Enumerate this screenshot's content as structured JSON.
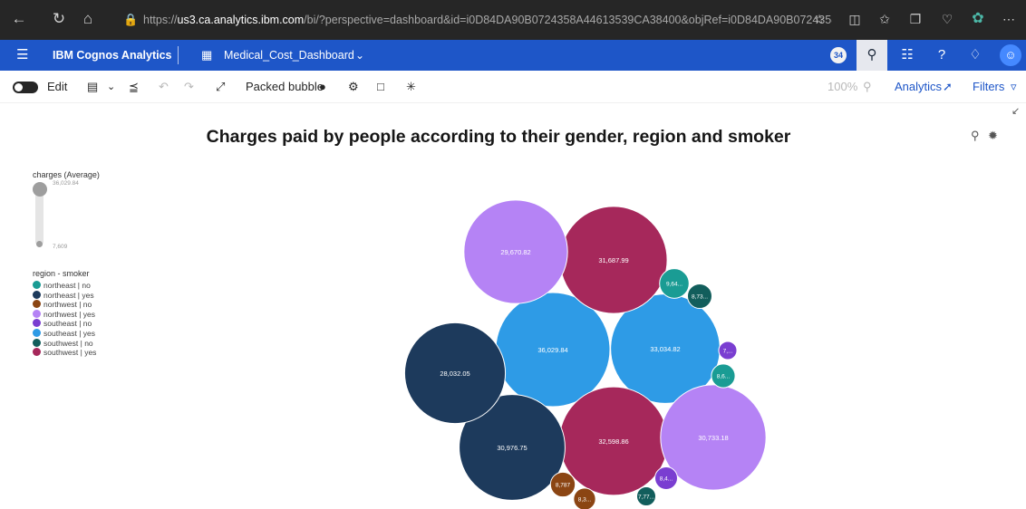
{
  "browser": {
    "url_prefix": "https://",
    "url_domain": "us3.ca.analytics.ibm.com",
    "url_rest": "/bi/?perspective=dashboard&id=i0D84DA90B0724358A44613539CA38400&objRef=i0D84DA90B0724358..."
  },
  "app": {
    "product": "IBM Cognos Analytics",
    "dashboard_name": "Medical_Cost_Dashboard",
    "notification_count": "34"
  },
  "toolbar": {
    "edit_label": "Edit",
    "visualization_label": "Packed bubble",
    "zoom_label": "100%",
    "analytics_label": "Analytics",
    "filters_label": "Filters"
  },
  "chart_data": {
    "type": "packed-bubble",
    "title": "Charges paid by people according to their gender, region and smoker",
    "size_legend": {
      "label": "charges (Average)",
      "max_label": "36,029.84",
      "min_label": "7,609"
    },
    "color_legend_title": "region - smoker",
    "categories": [
      {
        "name": "northeast | no",
        "color": "#1a9c94"
      },
      {
        "name": "northeast | yes",
        "color": "#1d3a5c"
      },
      {
        "name": "northwest | no",
        "color": "#8b4513"
      },
      {
        "name": "northwest | yes",
        "color": "#b583f5"
      },
      {
        "name": "southeast | no",
        "color": "#7a3ed1"
      },
      {
        "name": "southeast | yes",
        "color": "#2e9be6"
      },
      {
        "name": "southwest | no",
        "color": "#125e5c"
      },
      {
        "name": "southwest | yes",
        "color": "#a6285b"
      }
    ],
    "bubbles": [
      {
        "category": "southeast | yes",
        "value": 36029.84,
        "label": "36,029.84"
      },
      {
        "category": "southeast | yes",
        "value": 33034.82,
        "label": "33,034.82"
      },
      {
        "category": "southwest | yes",
        "value": 32598.86,
        "label": "32,598.86"
      },
      {
        "category": "southwest | yes",
        "value": 31687.99,
        "label": "31,687.99"
      },
      {
        "category": "northeast | yes",
        "value": 30976.75,
        "label": "30,976.75"
      },
      {
        "category": "northwest | yes",
        "value": 30733.18,
        "label": "30,733.18"
      },
      {
        "category": "northwest | yes",
        "value": 29670.82,
        "label": "29,670.82"
      },
      {
        "category": "northeast | yes",
        "value": 28032.05,
        "label": "28,032.05"
      },
      {
        "category": "northeast | no",
        "value": 9640,
        "label": "9,64..."
      },
      {
        "category": "southwest | no",
        "value": 8730,
        "label": "8,73..."
      },
      {
        "category": "northwest | no",
        "value": 8787,
        "label": "8,787"
      },
      {
        "category": "northeast | no",
        "value": 8600,
        "label": "8,6..."
      },
      {
        "category": "southeast | no",
        "value": 8400,
        "label": "8,4..."
      },
      {
        "category": "northwest | no",
        "value": 8300,
        "label": "8,3..."
      },
      {
        "category": "southwest | no",
        "value": 7770,
        "label": "7,77..."
      },
      {
        "category": "southeast | no",
        "value": 7609,
        "label": "7,..."
      }
    ]
  }
}
